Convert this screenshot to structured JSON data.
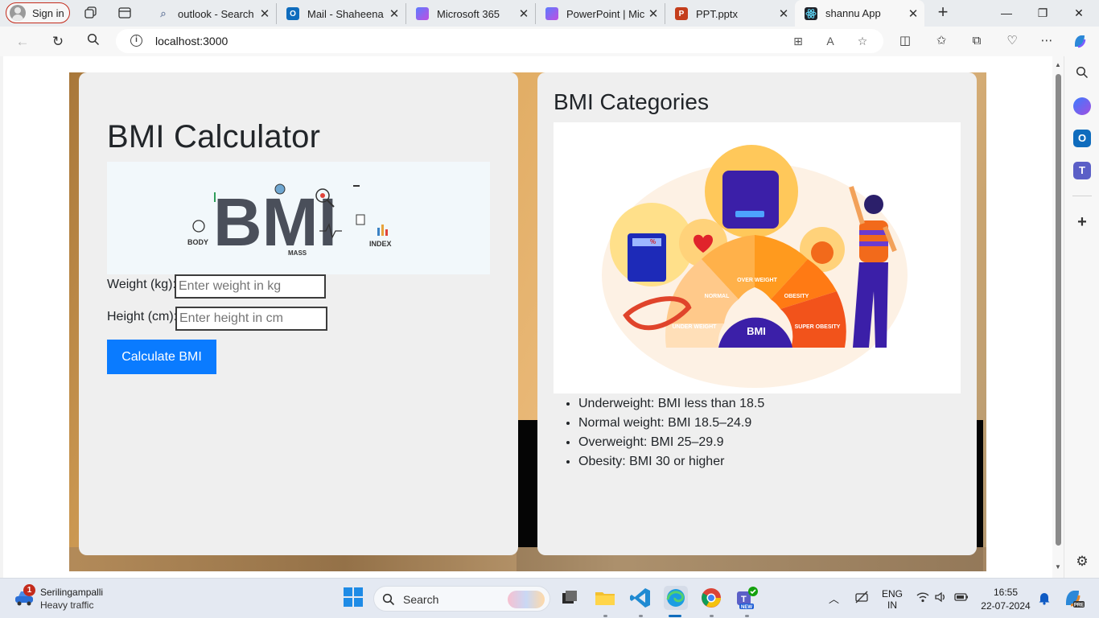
{
  "browser": {
    "signin_label": "Sign in",
    "tabs": [
      {
        "title": "outlook - Search",
        "icon": "search-icon"
      },
      {
        "title": "Mail - Shaheena P",
        "icon": "outlook-icon"
      },
      {
        "title": "Microsoft 365",
        "icon": "m365-icon"
      },
      {
        "title": "PowerPoint | Micr",
        "icon": "m365-icon"
      },
      {
        "title": "PPT.pptx",
        "icon": "powerpoint-icon"
      },
      {
        "title": "shannu App",
        "icon": "react-icon",
        "active": true
      }
    ],
    "url": "localhost:3000",
    "colors": {
      "signin_border": "#c42b1c",
      "active_tab": "#f7f7f7",
      "strip": "#e9ecef"
    }
  },
  "app": {
    "calculator": {
      "title": "BMI Calculator",
      "logo_text": {
        "main": "BMI",
        "body": "BODY",
        "mass": "MASS",
        "index": "INDEX"
      },
      "weight_label": "Weight (kg):",
      "weight_placeholder": "Enter weight in kg",
      "height_label": "Height (cm):",
      "height_placeholder": "Enter height in cm",
      "button_label": "Calculate BMI",
      "button_color": "#0a7bff"
    },
    "categories": {
      "title": "BMI Categories",
      "image_labels": {
        "under": "UNDER WEIGHT",
        "normal": "NORMAL",
        "over": "OVER WEIGHT",
        "obesity": "OBESITY",
        "super": "SUPER OBESITY",
        "center": "BMI",
        "calc_percent": "%"
      },
      "items": [
        "Underweight: BMI less than 18.5",
        "Normal weight: BMI 18.5–24.9",
        "Overweight: BMI 25–29.9",
        "Obesity: BMI 30 or higher"
      ]
    }
  },
  "taskbar": {
    "weather_location": "Serilingampalli",
    "weather_status": "Heavy traffic",
    "weather_badge": "1",
    "search_label": "Search",
    "language": "ENG",
    "region": "IN",
    "time": "16:55",
    "date": "22-07-2024",
    "teams_badge": "NEW",
    "copilot_badge": "PRE"
  }
}
